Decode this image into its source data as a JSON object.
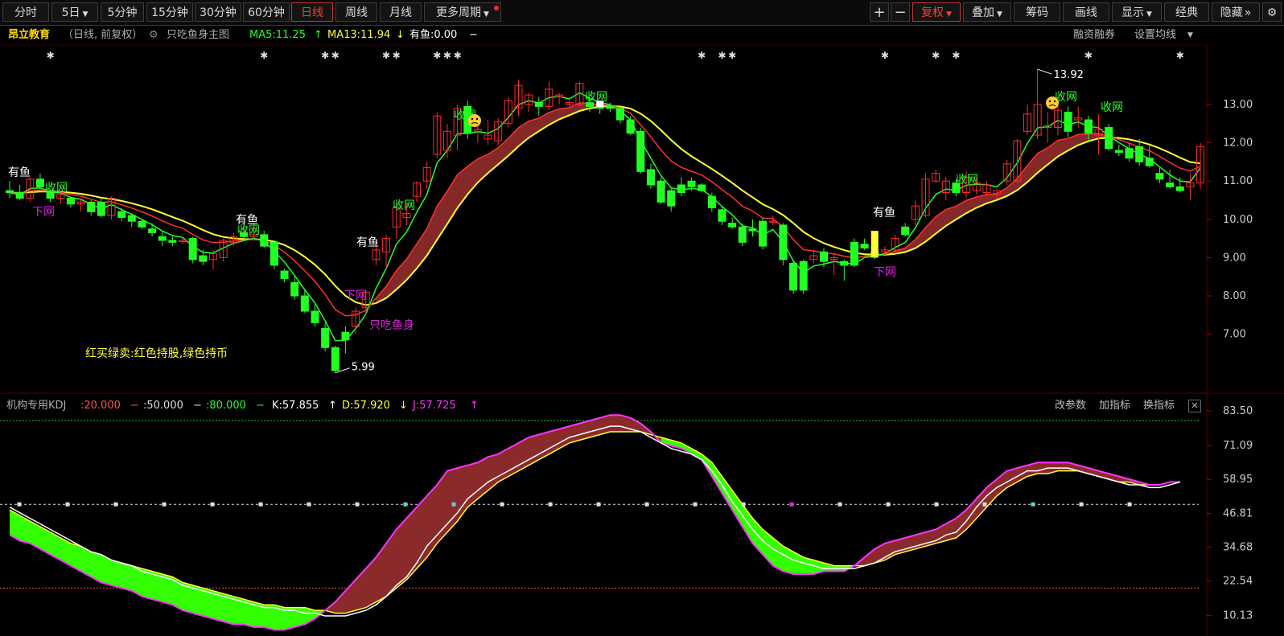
{
  "toolbar": {
    "periods": [
      "分时",
      "5日",
      "5分钟",
      "15分钟",
      "30分钟",
      "60分钟",
      "日线",
      "周线",
      "月线",
      "更多周期"
    ],
    "active_period": "日线",
    "tools": [
      "+",
      "−",
      "复权",
      "叠加",
      "筹码",
      "画线",
      "显示",
      "经典",
      "隐藏"
    ],
    "active_tool": "复权"
  },
  "info": {
    "stock_name": "昂立教育",
    "period_desc": "（日线, 前复权）",
    "indicator_name": "只吃鱼身主图",
    "ma5": "MA5:11.25",
    "ma5_arrow": "↑",
    "ma13": "MA13:11.94",
    "ma13_arrow": "↓",
    "youyu_val": "有鱼:0.00",
    "youyu_dash": "−",
    "right_links": [
      "融资融券",
      "设置均线"
    ]
  },
  "kdj": {
    "name": "机构专用KDJ",
    "l20": ":20.000",
    "l50": ":50.000",
    "l80": ":80.000",
    "k": "K:57.855",
    "k_arrow": "↑",
    "d": "D:57.920",
    "d_arrow": "↓",
    "j": "J:57.725",
    "j_arrow": "↑",
    "links": [
      "改参数",
      "加指标",
      "换指标"
    ]
  },
  "colors": {
    "up": "#ff2a2a",
    "down": "#22ff22",
    "ma_fast": "#22ff22",
    "ma_mid": "#ff3030",
    "ma_slow": "#ffff33",
    "band": "#8b2a2a",
    "kdj_up_fill": "#8b2a2a",
    "kdj_down_fill": "#33ff00",
    "j_line": "#ff33ff",
    "annotation_magenta": "#e020e0"
  },
  "chart_data": {
    "type": "candlestick",
    "price_axis": {
      "ticks": [
        "13.00",
        "12.00",
        "11.00",
        "10.00",
        "9.00",
        "8.00",
        "7.00"
      ],
      "range": [
        6.0,
        14.0
      ]
    },
    "kdj_axis": {
      "ticks": [
        "83.50",
        "71.09",
        "58.95",
        "46.81",
        "34.68",
        "22.54",
        "10.13"
      ],
      "range": [
        10.13,
        83.5
      ]
    },
    "extremes": {
      "high": "13.92",
      "low": "5.99"
    },
    "annotations": {
      "you_yu": "有鱼",
      "shou_wang": "收网",
      "xia_wang": "下网",
      "zhi_chi_yu_shen": "只吃鱼身",
      "legend_note": "红买绿卖:红色持股,绿色持币"
    },
    "candles": [
      [
        10.75,
        11.0,
        10.55,
        10.7
      ],
      [
        10.7,
        10.9,
        10.5,
        10.55
      ],
      [
        10.55,
        11.1,
        10.45,
        11.05
      ],
      [
        11.05,
        11.2,
        10.8,
        10.85
      ],
      [
        10.7,
        10.8,
        10.45,
        10.55
      ],
      [
        10.55,
        10.7,
        10.4,
        10.65
      ],
      [
        10.55,
        10.6,
        10.3,
        10.4
      ],
      [
        10.4,
        10.55,
        10.2,
        10.45
      ],
      [
        10.45,
        10.5,
        10.1,
        10.2
      ],
      [
        10.45,
        10.55,
        10.05,
        10.1
      ],
      [
        10.1,
        10.6,
        10.0,
        10.55
      ],
      [
        10.2,
        10.3,
        9.95,
        10.05
      ],
      [
        10.1,
        10.15,
        9.8,
        9.95
      ],
      [
        9.95,
        10.0,
        9.75,
        9.8
      ],
      [
        9.75,
        9.9,
        9.55,
        9.65
      ],
      [
        9.55,
        9.7,
        9.3,
        9.45
      ],
      [
        9.45,
        9.55,
        9.3,
        9.4
      ],
      [
        9.45,
        9.5,
        9.35,
        9.45
      ],
      [
        9.5,
        9.55,
        8.85,
        8.95
      ],
      [
        9.05,
        9.2,
        8.8,
        8.9
      ],
      [
        8.95,
        9.2,
        8.7,
        9.1
      ],
      [
        9.0,
        9.5,
        8.9,
        9.45
      ],
      [
        9.4,
        9.65,
        9.3,
        9.55
      ],
      [
        9.65,
        9.75,
        9.5,
        9.55
      ],
      [
        9.55,
        9.9,
        9.45,
        9.6
      ],
      [
        9.6,
        9.7,
        9.25,
        9.3
      ],
      [
        9.4,
        9.45,
        8.7,
        8.8
      ],
      [
        8.65,
        8.7,
        8.35,
        8.45
      ],
      [
        8.35,
        8.5,
        7.9,
        8.0
      ],
      [
        8.0,
        8.15,
        7.55,
        7.6
      ],
      [
        7.6,
        7.8,
        7.2,
        7.3
      ],
      [
        7.15,
        7.3,
        6.55,
        6.65
      ],
      [
        6.65,
        6.7,
        5.99,
        6.05
      ],
      [
        7.05,
        7.2,
        6.5,
        6.85
      ],
      [
        7.2,
        7.7,
        7.0,
        7.6
      ],
      [
        7.7,
        8.15,
        7.5,
        8.1
      ],
      [
        8.95,
        9.4,
        8.8,
        9.2
      ],
      [
        9.15,
        9.6,
        8.7,
        9.5
      ],
      [
        9.8,
        10.4,
        9.5,
        10.3
      ],
      [
        10.05,
        10.4,
        9.85,
        10.15
      ],
      [
        10.6,
        11.0,
        10.45,
        10.95
      ],
      [
        11.0,
        11.5,
        10.8,
        11.35
      ],
      [
        11.7,
        12.8,
        11.6,
        12.7
      ],
      [
        11.8,
        12.5,
        11.6,
        12.3
      ],
      [
        12.2,
        13.0,
        11.8,
        12.9
      ],
      [
        12.95,
        13.1,
        12.1,
        12.25
      ],
      [
        12.3,
        12.6,
        12.0,
        12.35
      ],
      [
        12.1,
        12.6,
        11.95,
        12.2
      ],
      [
        12.05,
        12.65,
        11.95,
        12.55
      ],
      [
        12.5,
        13.2,
        12.4,
        13.1
      ],
      [
        12.9,
        13.65,
        12.7,
        13.5
      ],
      [
        13.0,
        13.3,
        12.8,
        13.25
      ],
      [
        13.05,
        13.2,
        12.7,
        12.95
      ],
      [
        12.95,
        13.6,
        12.85,
        13.4
      ],
      [
        13.2,
        13.3,
        13.0,
        13.25
      ],
      [
        13.0,
        13.2,
        12.9,
        13.05
      ],
      [
        13.0,
        13.6,
        12.95,
        13.55
      ],
      [
        13.05,
        13.15,
        12.8,
        12.95
      ],
      [
        12.95,
        13.05,
        12.75,
        12.9
      ],
      [
        12.95,
        13.05,
        12.8,
        12.9
      ],
      [
        12.9,
        12.95,
        12.5,
        12.6
      ],
      [
        12.6,
        12.7,
        12.2,
        12.25
      ],
      [
        12.3,
        12.4,
        11.2,
        11.25
      ],
      [
        11.3,
        11.45,
        10.8,
        10.9
      ],
      [
        11.0,
        11.1,
        10.4,
        10.45
      ],
      [
        10.75,
        10.85,
        10.2,
        10.35
      ],
      [
        10.9,
        11.1,
        10.6,
        10.7
      ],
      [
        11.0,
        11.1,
        10.75,
        10.85
      ],
      [
        10.9,
        10.95,
        10.7,
        10.75
      ],
      [
        10.6,
        10.7,
        10.2,
        10.3
      ],
      [
        10.25,
        10.35,
        9.85,
        9.95
      ],
      [
        9.9,
        10.05,
        9.75,
        9.8
      ],
      [
        9.8,
        9.9,
        9.3,
        9.4
      ],
      [
        9.75,
        10.0,
        9.55,
        9.7
      ],
      [
        9.95,
        10.05,
        9.2,
        9.3
      ],
      [
        9.95,
        10.1,
        9.85,
        9.95
      ],
      [
        9.85,
        9.9,
        8.8,
        8.95
      ],
      [
        8.85,
        8.95,
        8.05,
        8.15
      ],
      [
        8.9,
        8.95,
        8.05,
        8.15
      ],
      [
        8.95,
        9.2,
        8.85,
        9.05
      ],
      [
        9.15,
        9.25,
        8.75,
        8.9
      ],
      [
        8.95,
        9.1,
        8.55,
        9.0
      ],
      [
        8.9,
        8.95,
        8.4,
        8.8
      ],
      [
        9.4,
        9.5,
        8.75,
        8.8
      ],
      [
        9.35,
        9.5,
        9.2,
        9.25
      ],
      [
        9.15,
        9.3,
        8.95,
        9.1
      ],
      [
        9.15,
        9.3,
        9.1,
        9.2
      ],
      [
        9.2,
        9.6,
        9.15,
        9.5
      ],
      [
        9.8,
        9.9,
        9.55,
        9.6
      ],
      [
        10.0,
        10.5,
        9.85,
        10.35
      ],
      [
        10.1,
        11.2,
        10.05,
        11.05
      ],
      [
        11.0,
        11.3,
        10.95,
        11.2
      ],
      [
        10.7,
        11.1,
        10.5,
        11.0
      ],
      [
        10.95,
        11.05,
        10.6,
        10.7
      ],
      [
        10.7,
        11.25,
        10.55,
        11.1
      ],
      [
        10.75,
        11.1,
        10.65,
        10.95
      ],
      [
        10.7,
        11.0,
        10.6,
        10.9
      ],
      [
        10.65,
        10.8,
        10.55,
        10.75
      ],
      [
        11.0,
        11.55,
        10.9,
        11.45
      ],
      [
        11.0,
        12.1,
        10.95,
        12.05
      ],
      [
        12.3,
        13.0,
        12.2,
        12.75
      ],
      [
        12.2,
        13.92,
        12.1,
        13.0
      ],
      [
        12.4,
        12.8,
        12.0,
        12.45
      ],
      [
        12.4,
        13.1,
        12.2,
        12.85
      ],
      [
        12.8,
        12.95,
        12.15,
        12.3
      ],
      [
        12.6,
        12.95,
        12.4,
        12.65
      ],
      [
        12.6,
        12.7,
        12.0,
        12.25
      ],
      [
        12.2,
        12.75,
        11.7,
        12.35
      ],
      [
        12.4,
        12.5,
        11.8,
        11.85
      ],
      [
        11.8,
        11.95,
        11.65,
        11.75
      ],
      [
        11.85,
        12.0,
        11.5,
        11.6
      ],
      [
        11.9,
        12.1,
        11.4,
        11.5
      ],
      [
        11.6,
        11.95,
        11.35,
        11.4
      ],
      [
        11.2,
        11.35,
        10.95,
        11.05
      ],
      [
        10.95,
        11.3,
        10.8,
        10.85
      ],
      [
        10.85,
        11.1,
        10.7,
        10.75
      ],
      [
        10.85,
        11.2,
        10.5,
        10.95
      ],
      [
        10.95,
        12.0,
        10.8,
        11.9
      ]
    ],
    "kdj_k": [
      49,
      47,
      45,
      43,
      41,
      39,
      37,
      35,
      33,
      32,
      30,
      29,
      28,
      26,
      25,
      24,
      23,
      21,
      20,
      19,
      18,
      17,
      16,
      15,
      14,
      13,
      13,
      12,
      12,
      11,
      11,
      10,
      10,
      10,
      11,
      12,
      14,
      17,
      21,
      24,
      29,
      35,
      39,
      43,
      47,
      52,
      55,
      58,
      60,
      62,
      64,
      66,
      68,
      70,
      72,
      74,
      75,
      76,
      77,
      78,
      78,
      77,
      76,
      74,
      72,
      70,
      69,
      68,
      66,
      62,
      57,
      51,
      46,
      41,
      37,
      34,
      32,
      30,
      29,
      28,
      27,
      27,
      27,
      27,
      28,
      29,
      31,
      33,
      34,
      35,
      36,
      37,
      39,
      40,
      44,
      49,
      53,
      56,
      58,
      60,
      62,
      62,
      63,
      63,
      63,
      62,
      61,
      60,
      59,
      58,
      57,
      57,
      56,
      56,
      57,
      58
    ],
    "kdj_d": [
      48,
      46,
      44,
      42,
      40,
      38,
      36,
      35,
      33,
      32,
      30,
      29,
      28,
      27,
      26,
      25,
      24,
      22,
      21,
      20,
      19,
      18,
      17,
      16,
      15,
      14,
      14,
      13,
      13,
      13,
      12,
      12,
      11,
      11,
      12,
      13,
      15,
      17,
      20,
      23,
      27,
      31,
      36,
      40,
      44,
      49,
      52,
      55,
      58,
      60,
      62,
      64,
      66,
      68,
      70,
      72,
      73,
      74,
      75,
      76,
      76,
      76,
      76,
      75,
      74,
      73,
      72,
      70,
      68,
      65,
      60,
      55,
      50,
      45,
      41,
      38,
      35,
      33,
      31,
      30,
      29,
      28,
      28,
      28,
      28,
      29,
      30,
      32,
      33,
      34,
      35,
      36,
      37,
      38,
      41,
      45,
      49,
      53,
      56,
      58,
      60,
      61,
      61,
      62,
      62,
      62,
      61,
      60,
      59,
      58,
      58,
      57,
      57,
      57,
      58,
      58
    ],
    "kdj_j": [
      39,
      37,
      36,
      34,
      32,
      30,
      28,
      26,
      24,
      22,
      21,
      20,
      19,
      17,
      16,
      15,
      14,
      12,
      11,
      10,
      9,
      8,
      7,
      7,
      6,
      6,
      5,
      5,
      6,
      7,
      9,
      12,
      15,
      19,
      23,
      27,
      31,
      36,
      41,
      45,
      49,
      53,
      57,
      62,
      63,
      64,
      65,
      67,
      68,
      70,
      72,
      74,
      75,
      76,
      77,
      78,
      79,
      80,
      81,
      82,
      82,
      81,
      79,
      76,
      72,
      71,
      70,
      68,
      66,
      60,
      54,
      48,
      42,
      36,
      32,
      28,
      26,
      25,
      25,
      25,
      26,
      26,
      26,
      28,
      31,
      34,
      36,
      37,
      38,
      39,
      40,
      41,
      43,
      45,
      48,
      52,
      56,
      59,
      62,
      63,
      64,
      65,
      65,
      65,
      65,
      64,
      63,
      62,
      61,
      60,
      59,
      58,
      57,
      57,
      58,
      58
    ],
    "series": [
      {
        "name": "MA5"
      },
      {
        "name": "MA13"
      },
      {
        "name": "K"
      },
      {
        "name": "D"
      },
      {
        "name": "J"
      }
    ]
  }
}
